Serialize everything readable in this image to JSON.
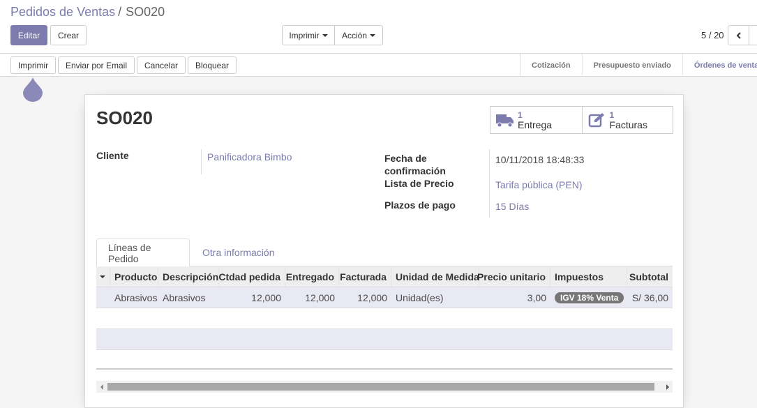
{
  "breadcrumb": {
    "parent": "Pedidos de Ventas",
    "separator": "/",
    "current": "SO020"
  },
  "toolbar": {
    "edit": "Editar",
    "create": "Crear",
    "print": "Imprimir",
    "action": "Acción"
  },
  "pager": {
    "value": "5 / 20"
  },
  "statusbar": {
    "buttons": {
      "print": "Imprimir",
      "email": "Enviar por Email",
      "cancel": "Cancelar",
      "lock": "Bloquear"
    },
    "stages": [
      "Cotización",
      "Presupuesto enviado",
      "Órdenes de venta"
    ],
    "active_stage": "Órdenes de venta"
  },
  "form": {
    "title": "SO020",
    "smart_buttons": [
      {
        "icon": "truck-icon",
        "count": "1",
        "label": "Entrega"
      },
      {
        "icon": "edit-icon",
        "count": "1",
        "label": "Facturas"
      }
    ],
    "customer_label": "Cliente",
    "customer": "Panificadora Bimbo",
    "confirmation_label_1": "Fecha de",
    "confirmation_label_2": "confirmación",
    "confirmation_date": "10/11/2018 18:48:33",
    "pricelist_label": "Lista de Precio",
    "pricelist": "Tarifa pública (PEN)",
    "payment_terms_label": "Plazos de pago",
    "payment_terms": "15 Días"
  },
  "tabs": [
    "Líneas de Pedido",
    "Otra información"
  ],
  "grid": {
    "columns": [
      "Producto",
      "Descripción",
      "Ctdad pedida",
      "Entregado",
      "Facturada",
      "Unidad de Medida",
      "Precio unitario",
      "Impuestos",
      "Subtotal"
    ],
    "rows": [
      {
        "product": "Abrasivos",
        "description": "Abrasivos",
        "qty": "12,000",
        "delivered": "12,000",
        "invoiced": "12,000",
        "uom": "Unidad(es)",
        "price": "3,00",
        "tax": "IGV 18% Venta",
        "subtotal": "S/ 36,00"
      }
    ]
  },
  "colors": {
    "accent": "#7c7bad",
    "tax_badge": "#777777"
  }
}
